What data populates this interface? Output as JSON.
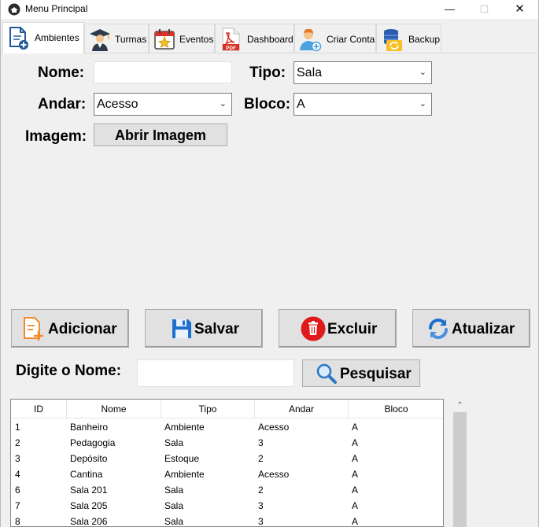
{
  "window": {
    "title": "Menu Principal",
    "min_glyph": "—",
    "max_glyph": "☐",
    "close_glyph": "✕"
  },
  "tabs": [
    {
      "label": "Ambientes",
      "icon": "document-add-icon",
      "active": true
    },
    {
      "label": "Turmas",
      "icon": "graduate-icon",
      "active": false
    },
    {
      "label": "Eventos",
      "icon": "calendar-star-icon",
      "active": false
    },
    {
      "label": "Dashboard",
      "icon": "pdf-icon",
      "active": false
    },
    {
      "label": "Criar Conta",
      "icon": "add-user-icon",
      "active": false
    },
    {
      "label": "Backup",
      "icon": "database-backup-icon",
      "active": false
    }
  ],
  "form": {
    "nome_label": "Nome:",
    "nome_value": "",
    "tipo_label": "Tipo:",
    "tipo_value": "Sala",
    "andar_label": "Andar:",
    "andar_value": "Acesso",
    "bloco_label": "Bloco:",
    "bloco_value": "A",
    "imagem_label": "Imagem:",
    "abrir_imagem_label": "Abrir Imagem"
  },
  "actions": {
    "adicionar": "Adicionar",
    "salvar": "Salvar",
    "excluir": "Excluir",
    "atualizar": "Atualizar"
  },
  "search": {
    "label": "Digite o Nome:",
    "value": "",
    "button": "Pesquisar"
  },
  "table": {
    "columns": [
      "ID",
      "Nome",
      "Tipo",
      "Andar",
      "Bloco"
    ],
    "rows": [
      [
        "1",
        "Banheiro",
        "Ambiente",
        "Acesso",
        "A"
      ],
      [
        "2",
        "Pedagogia",
        "Sala",
        "3",
        "A"
      ],
      [
        "3",
        "Depósito",
        "Estoque",
        "2",
        "A"
      ],
      [
        "4",
        "Cantina",
        "Ambiente",
        "Acesso",
        "A"
      ],
      [
        "6",
        "Sala 201",
        "Sala",
        "2",
        "A"
      ],
      [
        "7",
        "Sala 205",
        "Sala",
        "3",
        "A"
      ],
      [
        "8",
        "Sala 206",
        "Sala",
        "3",
        "A"
      ]
    ]
  },
  "colors": {
    "accent_blue": "#1f6fd1",
    "delete_red": "#e0191b",
    "add_orange": "#f28b2c"
  }
}
